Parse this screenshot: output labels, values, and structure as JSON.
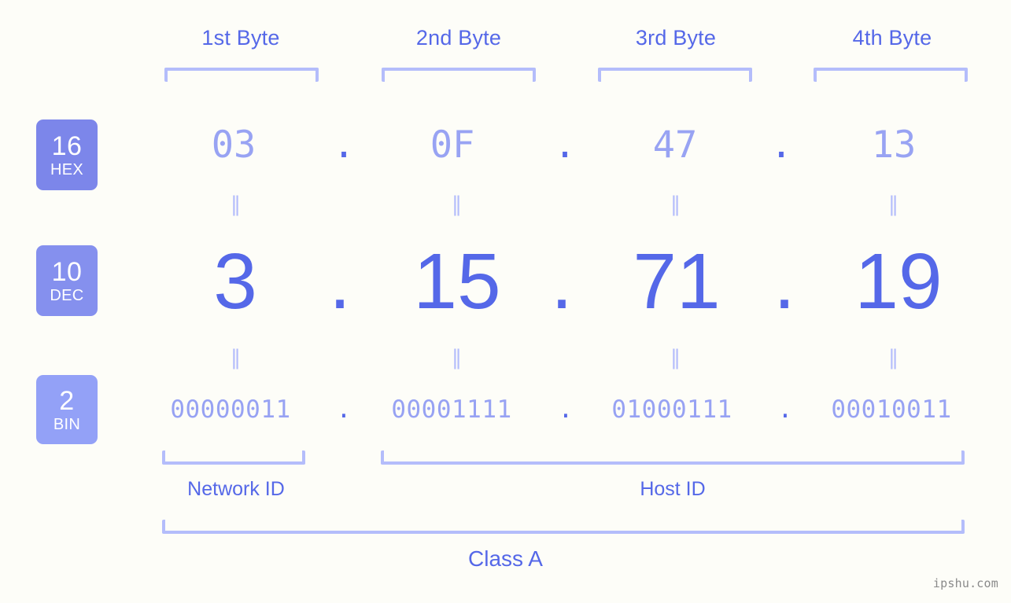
{
  "watermark": "ipshu.com",
  "byte_headers": [
    {
      "label": "1st Byte"
    },
    {
      "label": "2nd Byte"
    },
    {
      "label": "3rd Byte"
    },
    {
      "label": "4th Byte"
    }
  ],
  "radix_badges": [
    {
      "number": "16",
      "name": "HEX",
      "color": "#7c86ea"
    },
    {
      "number": "10",
      "name": "DEC",
      "color": "#8590ee"
    },
    {
      "number": "2",
      "name": "BIN",
      "color": "#93a1f7"
    }
  ],
  "separator": ".",
  "equivalence_mark": "‖",
  "rows": {
    "hex": {
      "radix": "16",
      "name": "HEX",
      "octets": [
        "03",
        "0F",
        "47",
        "13"
      ]
    },
    "dec": {
      "radix": "10",
      "name": "DEC",
      "octets": [
        "3",
        "15",
        "71",
        "19"
      ]
    },
    "bin": {
      "radix": "2",
      "name": "BIN",
      "octets": [
        "00000011",
        "00001111",
        "01000111",
        "00010011"
      ]
    }
  },
  "ip_address": {
    "hex": "03.0F.47.13",
    "decimal": "3.15.71.19",
    "binary": "00000011.00001111.01000111.00010011"
  },
  "partitions": {
    "network_id": {
      "label": "Network ID",
      "octets": 1
    },
    "host_id": {
      "label": "Host ID",
      "octets": 3
    }
  },
  "class": {
    "label": "Class A"
  },
  "colors": {
    "background": "#fdfdf8",
    "accent_strong": "#5568e8",
    "accent_light": "#98a3f3",
    "bracket": "#b4bdfb",
    "watermark": "#8a8a8a"
  }
}
